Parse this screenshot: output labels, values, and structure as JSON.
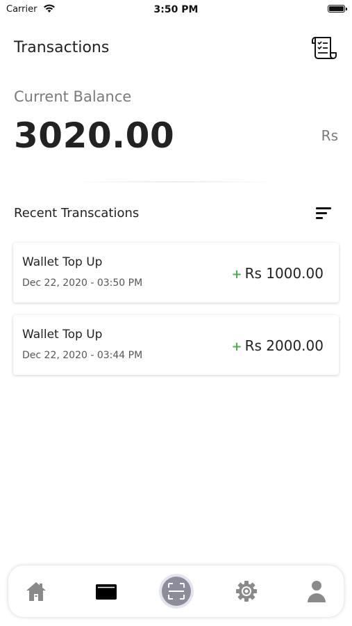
{
  "status_bar": {
    "carrier": "Carrier",
    "time": "3:50 PM"
  },
  "header": {
    "title": "Transactions",
    "receipt_icon": "receipt-icon"
  },
  "balance": {
    "label": "Current Balance",
    "amount": "3020.00",
    "currency": "Rs"
  },
  "recent": {
    "title": "Recent Transcations",
    "sort_icon": "sort-icon",
    "items": [
      {
        "title": "Wallet Top Up",
        "date": "Dec 22, 2020 - 03:50 PM",
        "sign": "+",
        "amount": "Rs 1000.00"
      },
      {
        "title": "Wallet Top Up",
        "date": "Dec 22, 2020 - 03:44 PM",
        "sign": "+",
        "amount": "Rs 2000.00"
      }
    ]
  },
  "bottom_nav": {
    "items": [
      {
        "icon": "home-icon",
        "active": false
      },
      {
        "icon": "wallet-icon",
        "active": true
      },
      {
        "icon": "scan-icon",
        "active": false
      },
      {
        "icon": "settings-icon",
        "active": false
      },
      {
        "icon": "profile-icon",
        "active": false
      }
    ]
  },
  "colors": {
    "positive": "#4caf50",
    "muted": "#7a7a7a",
    "text": "#222222"
  }
}
